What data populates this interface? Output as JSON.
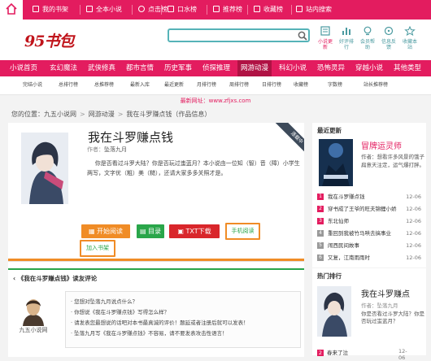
{
  "topbar": {
    "items": [
      {
        "label": "我的书架"
      },
      {
        "label": "全本小说"
      },
      {
        "label": "点击榜"
      },
      {
        "label": "口水榜"
      },
      {
        "label": "推荐榜"
      },
      {
        "label": "收藏榜"
      },
      {
        "label": "站内搜索"
      }
    ]
  },
  "header": {
    "logo": "95书包",
    "icons": [
      {
        "label": "小说更新",
        "icon": "book-update-icon"
      },
      {
        "label": "好评排行",
        "icon": "chart-icon"
      },
      {
        "label": "会员帮助",
        "icon": "bulb-icon"
      },
      {
        "label": "信息反馈",
        "icon": "feedback-icon"
      },
      {
        "label": "收藏本站",
        "icon": "star-icon"
      }
    ]
  },
  "nav": {
    "items": [
      "小说首页",
      "玄幻魔法",
      "武侠修真",
      "都市言情",
      "历史军事",
      "侦探推理",
      "网游动漫",
      "科幻小说",
      "恐怖灵异",
      "穿越小说",
      "其他类型"
    ]
  },
  "subnav": {
    "items": [
      "完结小说",
      "总排行榜",
      "总推荐榜",
      "最新入库",
      "最近更新",
      "月排行榜",
      "周排行榜",
      "日排行榜",
      "收藏榜",
      "字数榜",
      "站长推荐榜"
    ]
  },
  "notice": "最新网址：www.zfjxs.com",
  "breadcrumb": {
    "label": "您的位置：",
    "site": "九五小说网",
    "category": "网游动漫",
    "book": "我在斗罗赚点钱（作品信息）"
  },
  "book": {
    "ribbon": "连载中",
    "title": "我在斗罗赚点钱",
    "author_label": "作者：",
    "author": "坠落九月",
    "desc": "你是否看过斗罗大陆？你是否玩过蚩蓝月？本小说由一位知（智）音（障）小学生两写，文字优（粗）美（糙），还请大家多多关照才是。"
  },
  "buttons": {
    "read": "开始阅读",
    "toc": "目录",
    "txt": "TXT下载",
    "mobile": "手机阅读",
    "shelf": "加入书架"
  },
  "comments": {
    "title": "《我在斗罗赚点钱》读友评论",
    "avatar_name": "九五小说网",
    "lines": [
      "· 您想对坠落九月说点什么？",
      "· 你想说《我在斗罗赚点钱》写得怎么样？",
      "· 请发表您最想说的话吧对本书最真诚的评价！题延或者注册后就可以发表！",
      "· 坠落九月写《我在斗罗赚点钱》不容易，请不要发表攻击性语言！"
    ]
  },
  "latest": {
    "title": "最近更新",
    "featured": {
      "title": "冒牌运灵师",
      "author_label": "作者：",
      "author": "想看许多风景的饿子",
      "desc": "扁意天注定，运气爆打胖。"
    },
    "rows": [
      {
        "n": "1",
        "title": "我在斗罗赚点钱",
        "date": "12-06"
      },
      {
        "n": "2",
        "title": "穿书成了王爷的旺夫锦鲤小娇",
        "date": "12-06"
      },
      {
        "n": "3",
        "title": "东北仙师",
        "date": "12-06"
      },
      {
        "n": "4",
        "title": "重回到我被竹马哄去搞事业",
        "date": "12-06"
      },
      {
        "n": "5",
        "title": "闹西民间故事",
        "date": "12-06"
      },
      {
        "n": "6",
        "title": "又复，江南雨雨时",
        "date": "12-06"
      }
    ],
    "colors": {
      "top3": "#e31c5f",
      "rest": "#999999"
    }
  },
  "hot": {
    "title": "热门排行",
    "top": {
      "title": "我在斗罗赚点",
      "author_label": "作者：",
      "author": "坠落九月",
      "desc": "你是否看过斗罗大陆？你是否玩过蚩蓝月？"
    },
    "second": {
      "n": "2",
      "title": "春来了泣",
      "date": "12-06"
    }
  },
  "colors": {
    "brand": "#e31c5f",
    "accent_orange": "#f08c26",
    "green": "#2aa64a",
    "red": "#d9262b",
    "teal": "#56b3b8"
  }
}
